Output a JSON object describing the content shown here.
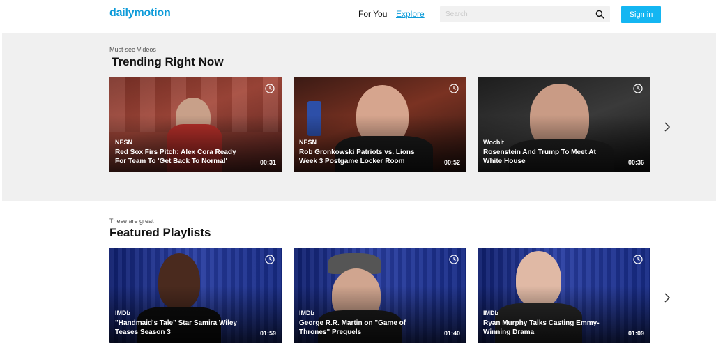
{
  "header": {
    "logo": "dailymotion",
    "nav": {
      "for_you": "For You",
      "explore": "Explore"
    },
    "search": {
      "placeholder": "Search",
      "value": ""
    },
    "signin_label": "Sign in"
  },
  "trending": {
    "kicker": "Must-see Videos",
    "title": "Trending Right Now",
    "videos": [
      {
        "source": "NESN",
        "title": "Red Sox Firs Pitch: Alex Cora Ready For Team To 'Get Back To Normal'",
        "duration": "00:31"
      },
      {
        "source": "NESN",
        "title": "Rob Gronkowski Patriots vs. Lions Week 3 Postgame Locker Room",
        "duration": "00:52"
      },
      {
        "source": "Wochit",
        "title": "Rosenstein And Trump To Meet At White House",
        "duration": "00:36"
      }
    ]
  },
  "featured": {
    "kicker": "These are great",
    "title": "Featured Playlists",
    "videos": [
      {
        "source": "IMDb",
        "title": "\"Handmaid's Tale\" Star Samira Wiley Teases Season 3",
        "duration": "01:59"
      },
      {
        "source": "IMDb",
        "title": "George R.R. Martin on \"Game of Thrones\" Prequels",
        "duration": "01:40"
      },
      {
        "source": "IMDb",
        "title": "Ryan Murphy Talks Casting Emmy-Winning Drama",
        "duration": "01:09"
      }
    ]
  },
  "colors": {
    "brand": "#0d9bd9",
    "signin": "#14b6f2",
    "section_bg": "#f0f0f0"
  },
  "icons": [
    "search-icon",
    "clock-icon",
    "chevron-right-icon"
  ]
}
